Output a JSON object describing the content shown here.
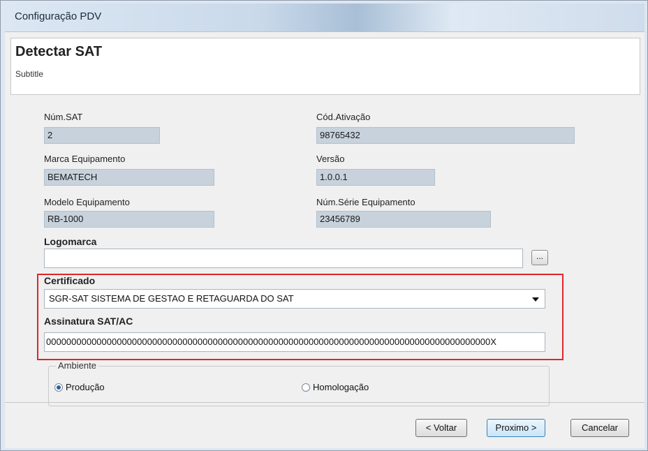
{
  "window": {
    "title": "Configuração PDV"
  },
  "header": {
    "title": "Detectar SAT",
    "subtitle": "Subtitle"
  },
  "fields": {
    "num_sat": {
      "label": "Núm.SAT",
      "value": "2"
    },
    "cod_ativacao": {
      "label": "Cód.Ativação",
      "value": "98765432"
    },
    "marca": {
      "label": "Marca Equipamento",
      "value": "BEMATECH"
    },
    "versao": {
      "label": "Versão",
      "value": "1.0.0.1"
    },
    "modelo": {
      "label": "Modelo Equipamento",
      "value": "RB-1000"
    },
    "num_serie": {
      "label": "Núm.Série Equipamento",
      "value": "23456789"
    },
    "logomarca": {
      "label": "Logomarca",
      "value": "",
      "browse_label": "..."
    },
    "certificado": {
      "label": "Certificado",
      "value": "SGR-SAT SISTEMA DE GESTAO E RETAGUARDA DO SAT"
    },
    "assinatura": {
      "label": "Assinatura SAT/AC",
      "value": "0000000000000000000000000000000000000000000000000000000000000000000000000000000000000000X"
    }
  },
  "ambiente": {
    "legend": "Ambiente",
    "options": [
      {
        "label": "Produção",
        "selected": true
      },
      {
        "label": "Homologação",
        "selected": false
      }
    ]
  },
  "buttons": {
    "back": "< Voltar",
    "next": "Proximo >",
    "cancel": "Cancelar"
  },
  "colors": {
    "highlight": "#e0262a",
    "readonly_field": "#c7d2dc"
  }
}
